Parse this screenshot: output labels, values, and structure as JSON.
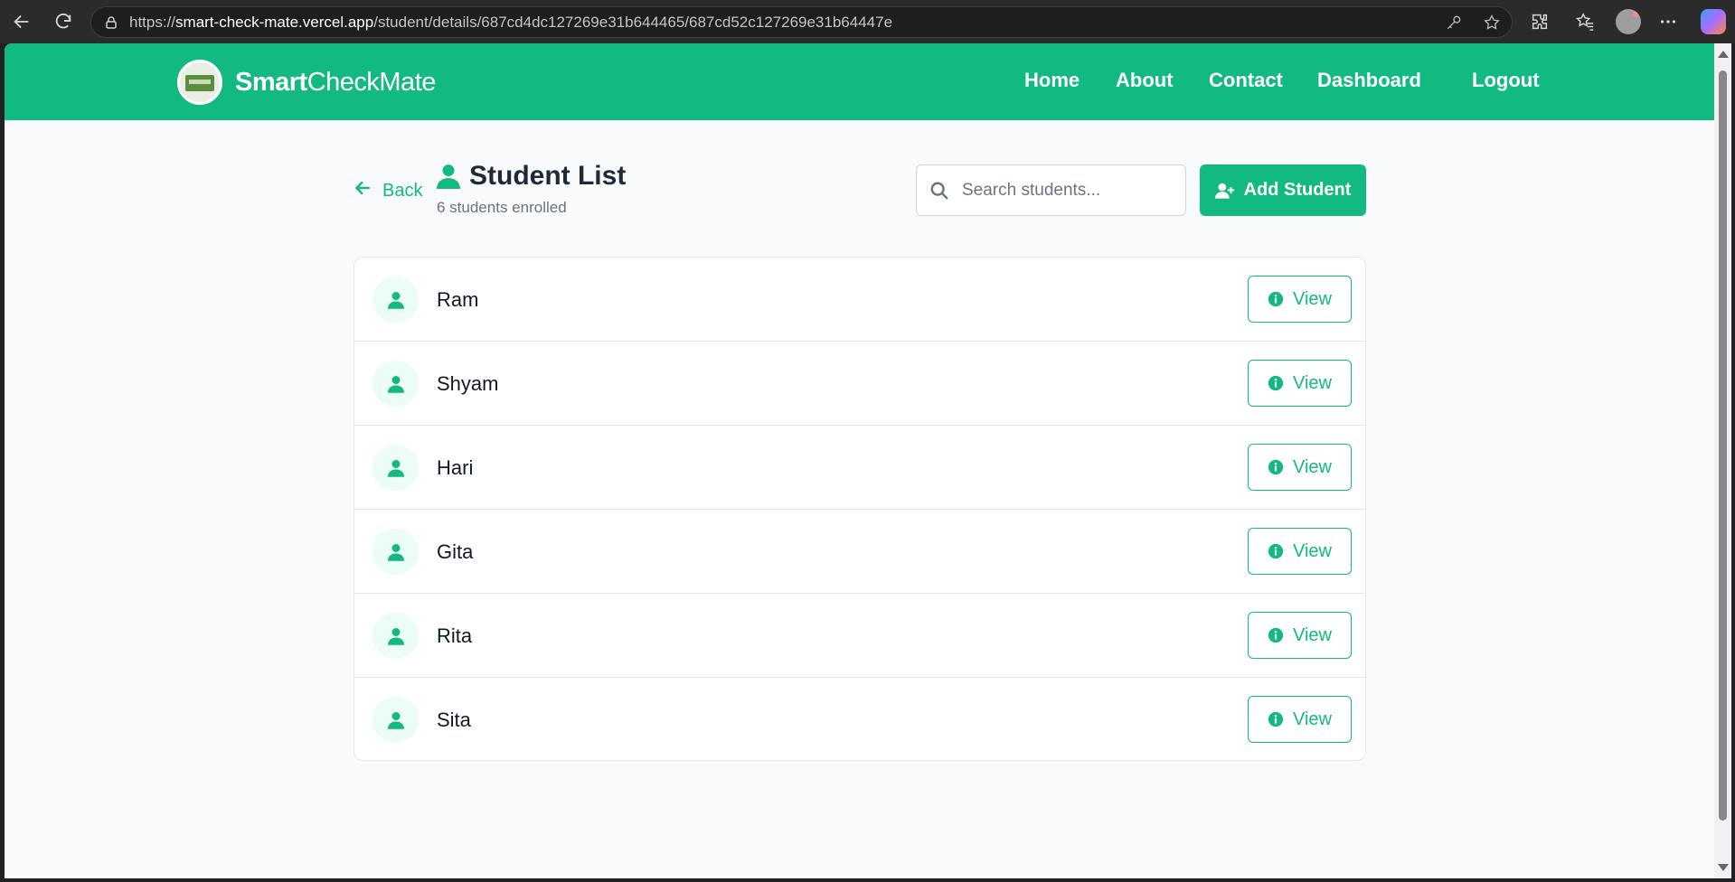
{
  "browser": {
    "url_prefix": "https://",
    "url_host": "smart-check-mate.vercel.app",
    "url_path": "/student/details/687cd4dc127269e31b644465/687cd52c127269e31b64447e"
  },
  "navbar": {
    "brand_bold": "Smart",
    "brand_rest": "CheckMate",
    "links": [
      "Home",
      "About",
      "Contact",
      "Dashboard",
      "Logout"
    ]
  },
  "header": {
    "back_label": "Back",
    "title": "Student List",
    "subtitle": "6 students enrolled"
  },
  "search": {
    "placeholder": "Search students..."
  },
  "add_button": {
    "label": "Add Student"
  },
  "students": [
    {
      "name": "Ram",
      "action": "View"
    },
    {
      "name": "Shyam",
      "action": "View"
    },
    {
      "name": "Hari",
      "action": "View"
    },
    {
      "name": "Gita",
      "action": "View"
    },
    {
      "name": "Rita",
      "action": "View"
    },
    {
      "name": "Sita",
      "action": "View"
    }
  ],
  "colors": {
    "primary": "#12b981",
    "page_bg": "#f8fafb",
    "text_dark": "#1f2937",
    "text_muted": "#6b7280"
  },
  "icons": {
    "back": "arrow-left-icon",
    "title": "user-icon",
    "search": "search-icon",
    "add": "user-plus-icon",
    "avatar": "user-icon",
    "view": "info-circle-icon"
  }
}
